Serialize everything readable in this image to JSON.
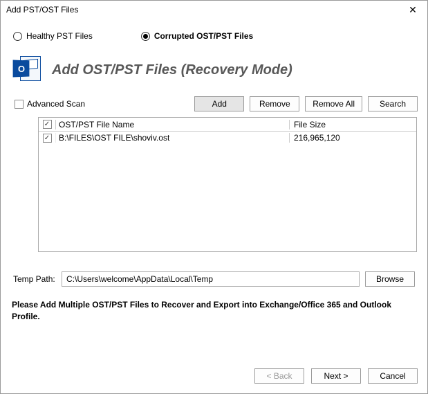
{
  "window": {
    "title": "Add PST/OST Files"
  },
  "radios": {
    "healthy": "Healthy PST Files",
    "corrupted": "Corrupted OST/PST Files"
  },
  "header": {
    "mode_title": "Add OST/PST Files (Recovery Mode)"
  },
  "options": {
    "advanced_scan": "Advanced Scan"
  },
  "buttons": {
    "add": "Add",
    "remove": "Remove",
    "remove_all": "Remove All",
    "search": "Search",
    "browse": "Browse",
    "back": "< Back",
    "next": "Next >",
    "cancel": "Cancel"
  },
  "table": {
    "col_name": "OST/PST File Name",
    "col_size": "File Size",
    "rows": [
      {
        "name": "B:\\FILES\\OST FILE\\shoviv.ost",
        "size": "216,965,120"
      }
    ]
  },
  "temp": {
    "label": "Temp Path:",
    "value": "C:\\Users\\welcome\\AppData\\Local\\Temp"
  },
  "instruction": "Please Add Multiple OST/PST Files to Recover and Export into Exchange/Office 365 and Outlook Profile."
}
